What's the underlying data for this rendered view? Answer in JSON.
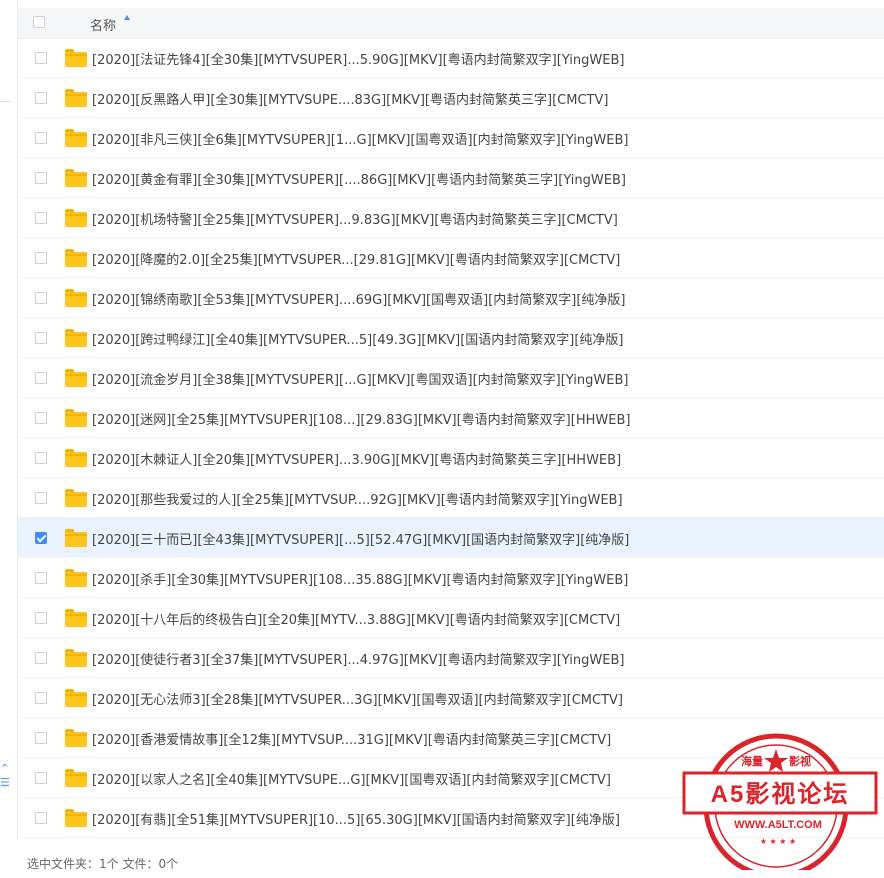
{
  "header": {
    "name_label": "名称"
  },
  "files": [
    {
      "name": "[2020][法证先锋4][全30集][MYTVSUPER]...5.90G][MKV][粤语内封简繁双字][YingWEB]",
      "checked": false
    },
    {
      "name": "[2020][反黑路人甲][全30集][MYTVSUPE....83G][MKV][粤语内封简繁英三字][CMCTV]",
      "checked": false
    },
    {
      "name": "[2020][非凡三侠][全6集][MYTVSUPER][1...G][MKV][国粤双语][内封简繁双字][YingWEB]",
      "checked": false
    },
    {
      "name": "[2020][黄金有罪][全30集][MYTVSUPER][....86G][MKV][粤语内封简繁英三字][YingWEB]",
      "checked": false
    },
    {
      "name": "[2020][机场特警][全25集][MYTVSUPER]...9.83G][MKV][粤语内封简繁英三字][CMCTV]",
      "checked": false
    },
    {
      "name": "[2020][降魔的2.0][全25集][MYTVSUPER...[29.81G][MKV][粤语内封简繁双字][CMCTV]",
      "checked": false
    },
    {
      "name": "[2020][锦绣南歌][全53集][MYTVSUPER]....69G][MKV][国粤双语][内封简繁双字][纯净版]",
      "checked": false
    },
    {
      "name": "[2020][跨过鸭绿江][全40集][MYTVSUPER...5][49.3G][MKV][国语内封简繁双字][纯净版]",
      "checked": false
    },
    {
      "name": "[2020][流金岁月][全38集][MYTVSUPER][...G][MKV][粤国双语][内封简繁双字][YingWEB]",
      "checked": false
    },
    {
      "name": "[2020][迷网][全25集][MYTVSUPER][108...][29.83G][MKV][粤语内封简繁双字][HHWEB]",
      "checked": false
    },
    {
      "name": "[2020][木棘证人][全20集][MYTVSUPER]...3.90G][MKV][粤语内封简繁英三字][HHWEB]",
      "checked": false
    },
    {
      "name": "[2020][那些我爱过的人][全25集][MYTVSUP....92G][MKV][粤语内封简繁双字][YingWEB]",
      "checked": false
    },
    {
      "name": "[2020][三十而已][全43集][MYTVSUPER][...5][52.47G][MKV][国语内封简繁双字][纯净版]",
      "checked": true
    },
    {
      "name": "[2020][杀手][全30集][MYTVSUPER][108...35.88G][MKV][粤语内封简繁双字][YingWEB]",
      "checked": false
    },
    {
      "name": "[2020][十八年后的终极告白][全20集][MYTV...3.88G][MKV][粤语内封简繁双字][CMCTV]",
      "checked": false
    },
    {
      "name": "[2020][使徒行者3][全37集][MYTVSUPER]...4.97G][MKV][粤语内封简繁双字][YingWEB]",
      "checked": false
    },
    {
      "name": "[2020][无心法师3][全28集][MYTVSUPER...3G][MKV][国粤双语][内封简繁双字][CMCTV]",
      "checked": false
    },
    {
      "name": "[2020][香港爱情故事][全12集][MYTVSUP....31G][MKV][粤语内封简繁英三字][CMCTV]",
      "checked": false
    },
    {
      "name": "[2020][以家人之名][全40集][MYTVSUPE...G][MKV][国粤双语][内封简繁双字][CMCTV]",
      "checked": false
    },
    {
      "name": "[2020][有翡][全51集][MYTVSUPER][10...5][65.30G][MKV][国语内封简繁双字][纯净版]",
      "checked": false
    }
  ],
  "footer": {
    "status": "选中文件夹：1个 文件：0个"
  },
  "watermark": {
    "top_left": "海量",
    "top_right": "影视",
    "main": "A5影视论坛",
    "url": "WWW.A5LT.COM"
  },
  "colors": {
    "accent": "#3b8cf5",
    "folder": "#ffc51d",
    "stamp": "#d9242b",
    "selected_row": "#eaf2fd"
  }
}
